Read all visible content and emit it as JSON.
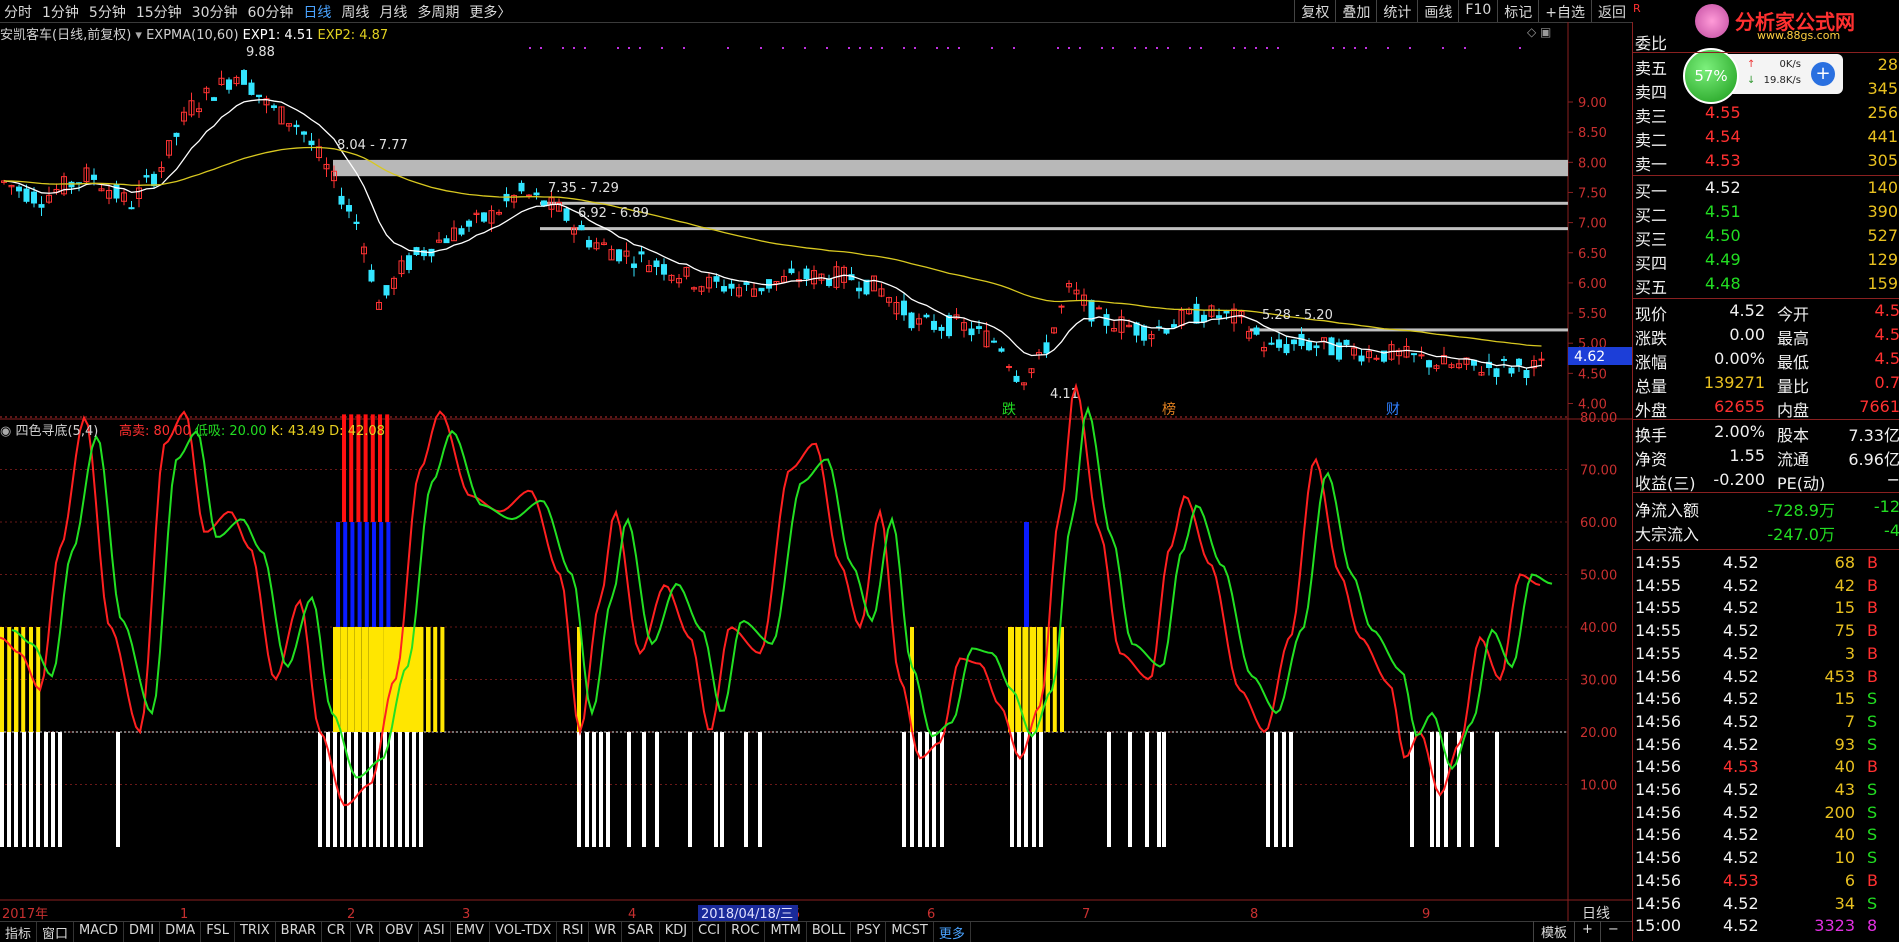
{
  "toolbar": {
    "periods": [
      "分时",
      "1分钟",
      "5分钟",
      "15分钟",
      "30分钟",
      "60分钟",
      "日线",
      "周线",
      "月线",
      "多周期",
      "更多〉"
    ],
    "active_period": "日线",
    "right_buttons": [
      "复权",
      "叠加",
      "统计",
      "画线",
      "F10",
      "标记",
      "+自选",
      "返回"
    ]
  },
  "main_chart": {
    "stock_title": "安凯客车(日线,前复权)",
    "indicator": "EXPMA(10,60)",
    "exp1_label": "EXP1: 4.51",
    "exp2_label": "EXP2: 4.87",
    "y_ticks": [
      "9.00",
      "8.50",
      "8.00",
      "7.50",
      "7.00",
      "6.50",
      "6.00",
      "5.50",
      "5.00",
      "4.50",
      "4.00"
    ],
    "annotations": [
      "9.88",
      "8.04 - 7.77",
      "7.35 - 7.29",
      "6.92 - 6.89",
      "5.28 - 5.20",
      "4.11"
    ],
    "price_tag": "4.62",
    "event_markers": [
      "跌",
      "榜",
      "财"
    ]
  },
  "sub_chart": {
    "indicator": "四色寻底(5,4)",
    "high_sell_label": "高卖:",
    "high_sell_value": "80.00",
    "low_buy_label": "低吸:",
    "low_buy_value": "20.00",
    "k_label": "K:",
    "k_value": "43.49",
    "d_label": "D:",
    "d_value": "42.08",
    "y_ticks": [
      "80.00",
      "70.00",
      "60.00",
      "50.00",
      "40.00",
      "30.00",
      "20.00",
      "10.00"
    ]
  },
  "x_axis": {
    "labels": [
      "2017年",
      "1",
      "2",
      "3",
      "4",
      "5",
      "6",
      "7",
      "8",
      "9"
    ],
    "cursor_date": "2018/04/18/三",
    "period_label": "日线"
  },
  "bottom_tabs": [
    "指标",
    "窗口",
    "MACD",
    "DMI",
    "DMA",
    "FSL",
    "TRIX",
    "BRAR",
    "CR",
    "VR",
    "OBV",
    "ASI",
    "EMV",
    "VOL-TDX",
    "RSI",
    "WR",
    "SAR",
    "KDJ",
    "CCI",
    "ROC",
    "MTM",
    "BOLL",
    "PSY",
    "MCST",
    "更多"
  ],
  "bottom_right": [
    "模板",
    "+",
    "−"
  ],
  "logo": {
    "text": "分析家公式网",
    "url_text": "www.88gs.com"
  },
  "network": {
    "percent": "57%",
    "up": "0K/s",
    "down": "19.8K/s"
  },
  "quote": {
    "weibi_label": "委比",
    "sells": [
      {
        "label": "卖五",
        "price": "",
        "vol": "28"
      },
      {
        "label": "卖四",
        "price": "",
        "vol": "345"
      },
      {
        "label": "卖三",
        "price": "4.55",
        "vol": "256"
      },
      {
        "label": "卖二",
        "price": "4.54",
        "vol": "441"
      },
      {
        "label": "卖一",
        "price": "4.53",
        "vol": "305"
      }
    ],
    "buys": [
      {
        "label": "买一",
        "price": "4.52",
        "vol": "140"
      },
      {
        "label": "买二",
        "price": "4.51",
        "vol": "390"
      },
      {
        "label": "买三",
        "price": "4.50",
        "vol": "527"
      },
      {
        "label": "买四",
        "price": "4.49",
        "vol": "129"
      },
      {
        "label": "买五",
        "price": "4.48",
        "vol": "159"
      }
    ],
    "stats": [
      {
        "l1": "现价",
        "v1": "4.52",
        "l2": "今开",
        "v2": "4.5"
      },
      {
        "l1": "涨跌",
        "v1": "0.00",
        "l2": "最高",
        "v2": "4.5"
      },
      {
        "l1": "涨幅",
        "v1": "0.00%",
        "l2": "最低",
        "v2": "4.5"
      },
      {
        "l1": "总量",
        "v1": "139271",
        "l2": "量比",
        "v2": "0.7"
      },
      {
        "l1": "外盘",
        "v1": "62655",
        "l2": "内盘",
        "v2": "7661"
      }
    ],
    "stats2": [
      {
        "l1": "换手",
        "v1": "2.00%",
        "l2": "股本",
        "v2": "7.33亿"
      },
      {
        "l1": "净资",
        "v1": "1.55",
        "l2": "流通",
        "v2": "6.96亿"
      },
      {
        "l1": "收益(三)",
        "v1": "-0.200",
        "l2": "PE(动)",
        "v2": "−"
      }
    ],
    "flows": [
      {
        "label": "净流入额",
        "v1": "-728.9万",
        "v2": "-12"
      },
      {
        "label": "大宗流入",
        "v1": "-247.0万",
        "v2": "-4"
      }
    ],
    "ticks": [
      {
        "t": "14:55",
        "p": "4.52",
        "v": "68",
        "s": "B"
      },
      {
        "t": "14:55",
        "p": "4.52",
        "v": "42",
        "s": "B"
      },
      {
        "t": "14:55",
        "p": "4.52",
        "v": "15",
        "s": "B"
      },
      {
        "t": "14:55",
        "p": "4.52",
        "v": "75",
        "s": "B"
      },
      {
        "t": "14:55",
        "p": "4.52",
        "v": "3",
        "s": "B"
      },
      {
        "t": "14:56",
        "p": "4.52",
        "v": "453",
        "s": "B"
      },
      {
        "t": "14:56",
        "p": "4.52",
        "v": "15",
        "s": "S"
      },
      {
        "t": "14:56",
        "p": "4.52",
        "v": "7",
        "s": "S"
      },
      {
        "t": "14:56",
        "p": "4.52",
        "v": "93",
        "s": "S"
      },
      {
        "t": "14:56",
        "p": "4.53",
        "v": "40",
        "s": "B"
      },
      {
        "t": "14:56",
        "p": "4.52",
        "v": "43",
        "s": "S"
      },
      {
        "t": "14:56",
        "p": "4.52",
        "v": "200",
        "s": "S"
      },
      {
        "t": "14:56",
        "p": "4.52",
        "v": "40",
        "s": "S"
      },
      {
        "t": "14:56",
        "p": "4.52",
        "v": "10",
        "s": "S"
      },
      {
        "t": "14:56",
        "p": "4.53",
        "v": "6",
        "s": "B"
      },
      {
        "t": "14:56",
        "p": "4.52",
        "v": "34",
        "s": "S"
      },
      {
        "t": "15:00",
        "p": "4.52",
        "v": "3323",
        "s": "8"
      }
    ]
  },
  "colors": {
    "up": "#ff3333",
    "down": "#33e5ff",
    "exp1": "#ffffff",
    "exp2": "#d8c820",
    "k": "#ff2020",
    "d": "#22e022",
    "bg": "#000000",
    "grid": "#8a2020"
  }
}
